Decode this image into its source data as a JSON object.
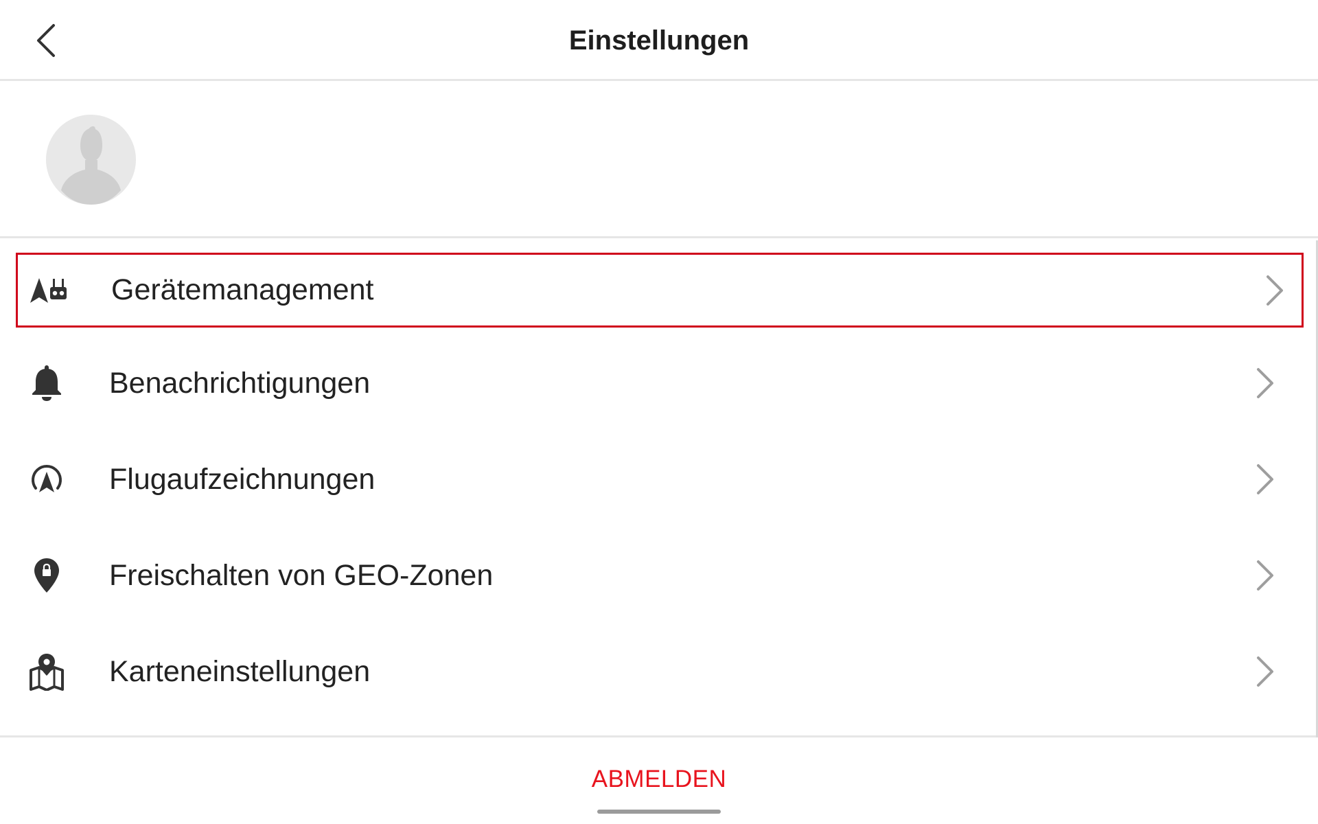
{
  "header": {
    "title": "Einstellungen",
    "back_icon": "chevron-left-icon"
  },
  "profile": {
    "avatar_icon": "user-silhouette-icon"
  },
  "menu": {
    "items": [
      {
        "label": "Gerätemanagement",
        "icon": "drone-controller-icon",
        "highlighted": true
      },
      {
        "label": "Benachrichtigungen",
        "icon": "bell-icon",
        "highlighted": false
      },
      {
        "label": "Flugaufzeichnungen",
        "icon": "flight-record-icon",
        "highlighted": false
      },
      {
        "label": "Freischalten von GEO-Zonen",
        "icon": "location-lock-icon",
        "highlighted": false
      },
      {
        "label": "Karteneinstellungen",
        "icon": "map-pin-icon",
        "highlighted": false
      }
    ]
  },
  "footer": {
    "logout_label": "ABMELDEN"
  },
  "colors": {
    "accent": "#e8141e",
    "highlight_border": "#d0021b",
    "icon": "#333333",
    "chevron": "#9e9e9e"
  }
}
